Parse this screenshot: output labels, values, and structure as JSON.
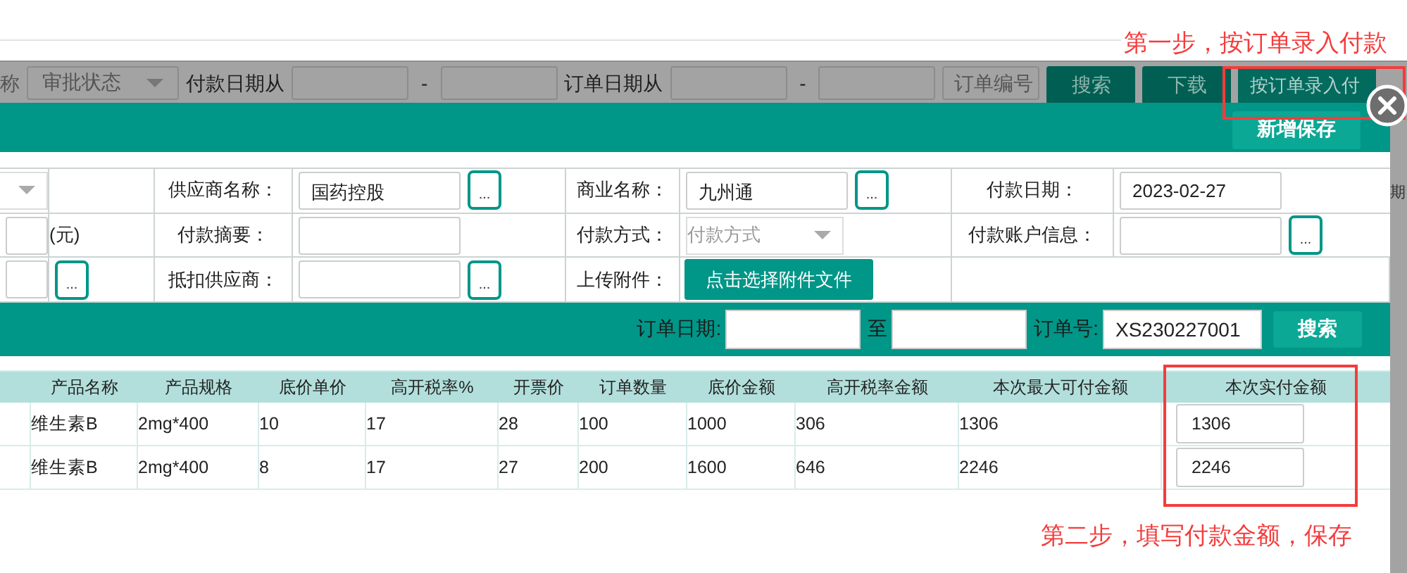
{
  "step_1_note": "第一步，按订单录入付款",
  "background_toolbar": {
    "cut_label": "称",
    "status_select": {
      "placeholder": "审批状态"
    },
    "payment_date_label": "付款日期从",
    "payment_dash": "-",
    "order_date_label": "订单日期从",
    "order_dash": "-",
    "order_number_field": {
      "placeholder": "订单编号"
    },
    "buttons": [
      "搜索",
      "下载",
      "按订单录入付"
    ]
  },
  "dialog": {
    "save_button": "新增保存",
    "right_edge_text": "期",
    "form_rows": [
      [
        {
          "kind": "select"
        },
        {
          "kind": "empty"
        },
        {
          "kind": "label",
          "text": "供应商名称："
        },
        {
          "kind": "picker",
          "value": "国药控股",
          "button": "..."
        },
        {
          "kind": "label",
          "text": "商业名称："
        },
        {
          "kind": "picker",
          "value": "九州通",
          "button": "..."
        },
        {
          "kind": "label",
          "text": "付款日期："
        },
        {
          "kind": "field",
          "value": "2023-02-27"
        }
      ],
      [
        {
          "kind": "field"
        },
        {
          "kind": "text",
          "text": "(元)"
        },
        {
          "kind": "label",
          "text": "付款摘要："
        },
        {
          "kind": "field"
        },
        {
          "kind": "label",
          "text": "付款方式："
        },
        {
          "kind": "select",
          "placeholder": "付款方式"
        },
        {
          "kind": "label",
          "text": "付款账户信息："
        },
        {
          "kind": "picker",
          "button": "..."
        }
      ],
      [
        {
          "kind": "field"
        },
        {
          "kind": "dots",
          "button": "..."
        },
        {
          "kind": "label",
          "text": "抵扣供应商："
        },
        {
          "kind": "picker",
          "button": "..."
        },
        {
          "kind": "label",
          "text": "上传附件："
        },
        {
          "kind": "upload",
          "button": "点击选择附件文件"
        },
        {
          "kind": "empty"
        }
      ]
    ],
    "search_bar": {
      "order_date_label": "订单日期:",
      "to_label": "至",
      "order_number_label": "订单号:",
      "order_number_value": "XS230227001",
      "search_button": "搜索"
    },
    "table": {
      "columns": [
        "产品名称",
        "产品规格",
        "底价单价",
        "高开税率%",
        "开票价",
        "订单数量",
        "底价金额",
        "高开税率金额",
        "本次最大可付金额",
        "本次实付金额"
      ],
      "rows": [
        {
          "cells": [
            "维生素B",
            "2mg*400",
            "10",
            "17",
            "28",
            "100",
            "1000",
            "306",
            "1306"
          ],
          "actual_payment": "1306"
        },
        {
          "cells": [
            "维生素B",
            "2mg*400",
            "8",
            "17",
            "27",
            "200",
            "1600",
            "646",
            "2246"
          ],
          "actual_payment": "2246"
        }
      ]
    },
    "step_2_note": "第二步，填写付款金额，保存"
  }
}
